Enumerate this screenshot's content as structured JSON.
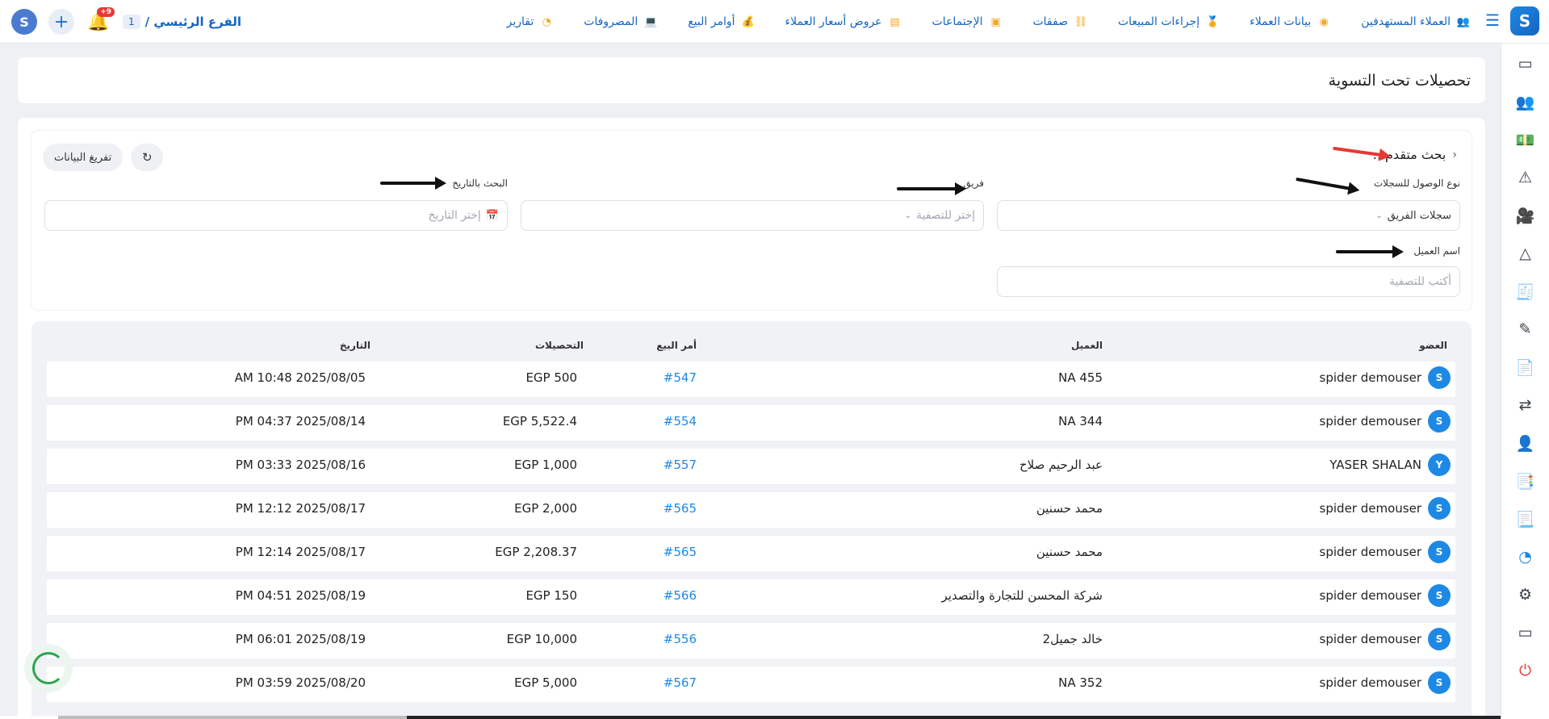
{
  "topbar": {
    "branch_label": "الفرع الرئيسي /",
    "branch_number": "1",
    "notification_count": "+9",
    "nav_items": [
      {
        "label": "العملاء المستهدفين",
        "icon": "target-customers-icon"
      },
      {
        "label": "بيانات العملاء",
        "icon": "customer-data-icon"
      },
      {
        "label": "إجراءات المبيعات",
        "icon": "sales-actions-icon"
      },
      {
        "label": "صفقات",
        "icon": "deals-icon"
      },
      {
        "label": "الإجتماعات",
        "icon": "meetings-icon"
      },
      {
        "label": "عروض أسعار العملاء",
        "icon": "quotes-icon"
      },
      {
        "label": "أوامر البيع",
        "icon": "sales-orders-icon"
      },
      {
        "label": "المصروفات",
        "icon": "expenses-icon"
      },
      {
        "label": "تقارير",
        "icon": "reports-icon"
      }
    ]
  },
  "page": {
    "title": "تحصيلات تحت التسوية"
  },
  "filters": {
    "advanced_search_label": "بحث متقدم...",
    "clear_button": "تفريغ البيانات",
    "access_type_label": "نوع الوصول للسجلات",
    "access_type_value": "سجلات الفريق",
    "team_label": "فريق",
    "team_placeholder": "إختر للتصفية",
    "date_label": "البحث بالتاريخ",
    "date_placeholder": "إختر التاريخ",
    "customer_name_label": "اسم العميل",
    "customer_name_placeholder": "أكتب للتصفية"
  },
  "table": {
    "headers": {
      "member": "العضو",
      "customer": "العميل",
      "sales_order": "أمر البيع",
      "collections": "التحصيلات",
      "date": "التاريخ"
    },
    "rows": [
      {
        "avatar": "S",
        "member": "spider demouser",
        "customer": "NA 455",
        "order": "#547",
        "amount": "EGP 500",
        "date": "AM 10:48 2025/08/05"
      },
      {
        "avatar": "S",
        "member": "spider demouser",
        "customer": "NA 344",
        "order": "#554",
        "amount": "EGP 5,522.4",
        "date": "PM 04:37 2025/08/14"
      },
      {
        "avatar": "Y",
        "member": "YASER SHALAN",
        "customer": "عبد الرحيم صلاح",
        "order": "#557",
        "amount": "EGP 1,000",
        "date": "PM 03:33 2025/08/16"
      },
      {
        "avatar": "S",
        "member": "spider demouser",
        "customer": "محمد حسنين",
        "order": "#565",
        "amount": "EGP 2,000",
        "date": "PM 12:12 2025/08/17"
      },
      {
        "avatar": "S",
        "member": "spider demouser",
        "customer": "محمد حسنين",
        "order": "#565",
        "amount": "EGP 2,208.37",
        "date": "PM 12:14 2025/08/17"
      },
      {
        "avatar": "S",
        "member": "spider demouser",
        "customer": "شركة المحسن للتجارة والتصدير",
        "order": "#566",
        "amount": "EGP 150",
        "date": "PM 04:51 2025/08/19"
      },
      {
        "avatar": "S",
        "member": "spider demouser",
        "customer": "خالد جميل2",
        "order": "#556",
        "amount": "EGP 10,000",
        "date": "PM 06:01 2025/08/19"
      },
      {
        "avatar": "S",
        "member": "spider demouser",
        "customer": "NA 352",
        "order": "#567",
        "amount": "EGP 5,000",
        "date": "PM 03:59 2025/08/20"
      }
    ]
  },
  "colors": {
    "accent": "#1e88e5",
    "brand": "#1565c0",
    "danger": "#e53935"
  }
}
